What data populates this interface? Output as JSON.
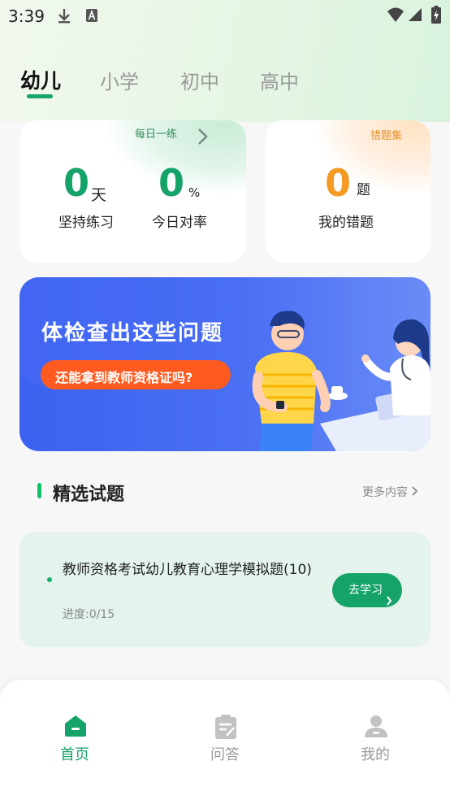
{
  "status_bar": {
    "time": "3:39",
    "icons": [
      "download-icon",
      "keyboard-a-icon",
      "wifi-icon",
      "signal-icon",
      "battery-charging-icon"
    ]
  },
  "tabs": [
    {
      "label": "幼儿",
      "active": true
    },
    {
      "label": "小学",
      "active": false
    },
    {
      "label": "初中",
      "active": false
    },
    {
      "label": "高中",
      "active": false
    }
  ],
  "practice_card": {
    "tag": "每日一练",
    "streak_value": "0",
    "streak_unit": "天",
    "streak_label": "坚持练习",
    "accuracy_value": "0",
    "accuracy_unit": "%",
    "accuracy_label": "今日对率"
  },
  "mistakes_card": {
    "tag": "错题集",
    "count_value": "0",
    "count_unit": "题",
    "label": "我的错题"
  },
  "banner": {
    "title": "体检查出这些问题",
    "subtitle": "还能拿到教师资格证吗?"
  },
  "section": {
    "title": "精选试题",
    "more": "更多内容"
  },
  "question": {
    "title": "教师资格考试幼儿教育心理学模拟题(10)",
    "progress": "进度:0/15",
    "button": "去学习"
  },
  "bottom_nav": [
    {
      "label": "首页",
      "icon": "home-icon",
      "active": true
    },
    {
      "label": "问答",
      "icon": "qa-clipboard-icon",
      "active": false
    },
    {
      "label": "我的",
      "icon": "profile-icon",
      "active": false
    }
  ],
  "colors": {
    "accent_green": "#15a36a",
    "accent_orange": "#f59a23",
    "banner_blue": "#3b62f0",
    "banner_pill": "#ff5a1f"
  }
}
